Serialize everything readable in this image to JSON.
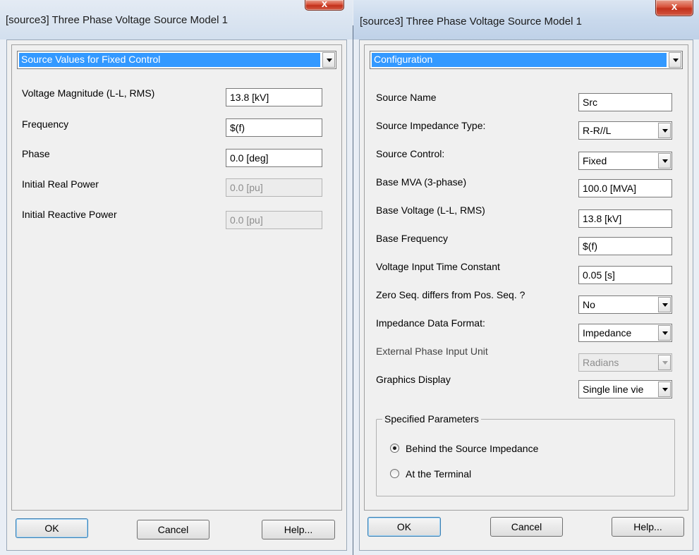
{
  "left_dialog": {
    "title": "[source3] Three Phase Voltage Source Model 1",
    "close_label": "x",
    "section_select": "Source Values for Fixed Control",
    "fields": [
      {
        "label": "Voltage Magnitude (L-L, RMS)",
        "value": "13.8 [kV]",
        "enabled": true
      },
      {
        "label": "Frequency",
        "value": "$(f)",
        "enabled": true
      },
      {
        "label": "Phase",
        "value": "0.0 [deg]",
        "enabled": true
      },
      {
        "label": "Initial Real Power",
        "value": "0.0 [pu]",
        "enabled": false
      },
      {
        "label": "Initial Reactive Power",
        "value": "0.0 [pu]",
        "enabled": false
      }
    ],
    "buttons": {
      "ok": "OK",
      "cancel": "Cancel",
      "help": "Help..."
    }
  },
  "right_dialog": {
    "title": "[source3] Three Phase Voltage Source Model 1",
    "close_label": "x",
    "section_select": "Configuration",
    "fields": [
      {
        "label": "Source Name",
        "value": "Src",
        "type": "text"
      },
      {
        "label": "Source Impedance Type:",
        "value": "R-R//L",
        "type": "select"
      },
      {
        "label": "Source Control:",
        "value": "Fixed",
        "type": "select"
      },
      {
        "label": "Base MVA (3-phase)",
        "value": "100.0 [MVA]",
        "type": "text"
      },
      {
        "label": "Base Voltage (L-L, RMS)",
        "value": "13.8 [kV]",
        "type": "text"
      },
      {
        "label": "Base Frequency",
        "value": "$(f)",
        "type": "text"
      },
      {
        "label": "Voltage Input Time Constant",
        "value": "0.05 [s]",
        "type": "text"
      },
      {
        "label": "Zero Seq. differs from Pos. Seq. ?",
        "value": "No",
        "type": "select"
      },
      {
        "label": "Impedance Data Format:",
        "value": "Impedance",
        "type": "select"
      },
      {
        "label": "External Phase Input Unit",
        "value": "Radians",
        "type": "select",
        "enabled": false
      },
      {
        "label": "Graphics Display",
        "value": "Single line vie",
        "type": "select"
      }
    ],
    "group": {
      "legend": "Specified Parameters",
      "options": [
        {
          "label": "Behind the Source Impedance",
          "selected": true
        },
        {
          "label": "At the Terminal",
          "selected": false
        }
      ]
    },
    "buttons": {
      "ok": "OK",
      "cancel": "Cancel",
      "help": "Help..."
    }
  },
  "colors": {
    "selection": "#3399ff",
    "client_bg": "#f0f0f0",
    "close_button": "#c2321c"
  }
}
